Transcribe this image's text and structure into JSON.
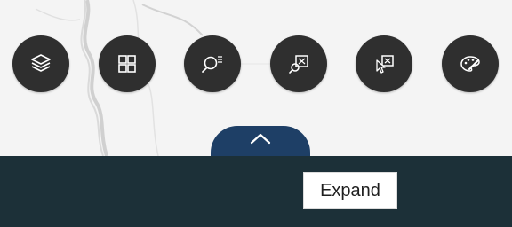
{
  "toolbar": {
    "buttons": [
      {
        "name": "layers-button",
        "icon": "layers-icon"
      },
      {
        "name": "grid-view-button",
        "icon": "grid-icon"
      },
      {
        "name": "search-button",
        "icon": "search-list-icon"
      },
      {
        "name": "query-map-button",
        "icon": "query-map-icon"
      },
      {
        "name": "select-on-map-button",
        "icon": "select-cursor-icon"
      },
      {
        "name": "basemap-style-button",
        "icon": "palette-icon"
      }
    ]
  },
  "expand_tab": {
    "icon": "chevron-up-icon"
  },
  "tooltip": {
    "text": "Expand"
  },
  "colors": {
    "button_bg": "#2f2f2f",
    "tab_bg": "#1e3f66",
    "bottom_band": "#1c3038",
    "map_bg": "#f4f4f4"
  }
}
